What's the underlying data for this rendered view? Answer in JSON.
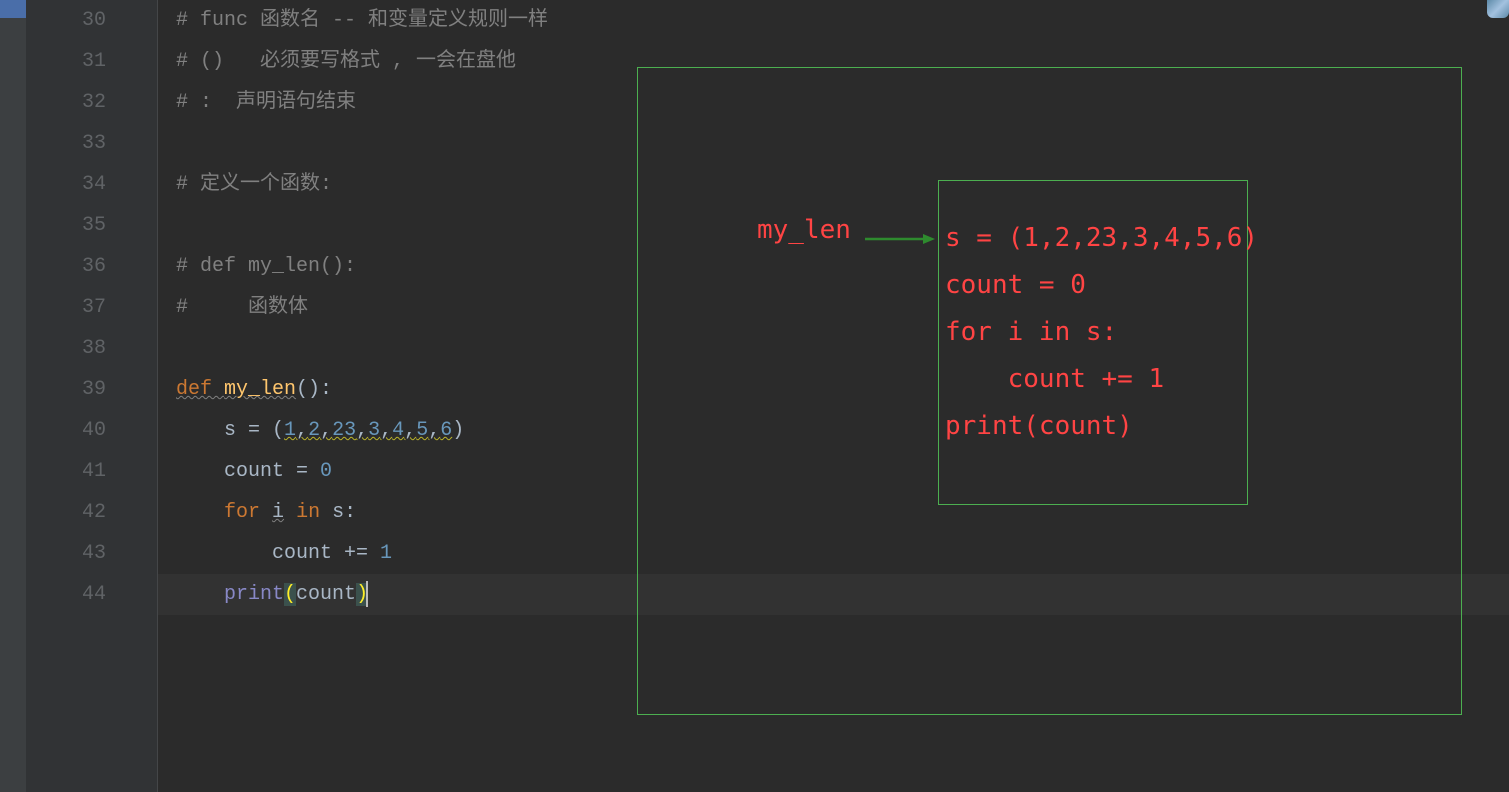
{
  "lines": [
    {
      "num": 30,
      "tokens": [
        [
          "comment",
          "# func 函数名 -- 和变量定义规则一样"
        ]
      ]
    },
    {
      "num": 31,
      "tokens": [
        [
          "comment",
          "# ()   必须要写格式 , 一会在盘他"
        ]
      ]
    },
    {
      "num": 32,
      "tokens": [
        [
          "comment",
          "# :  声明语句结束"
        ]
      ]
    },
    {
      "num": 33,
      "tokens": []
    },
    {
      "num": 34,
      "tokens": [
        [
          "comment",
          "# 定义一个函数:"
        ]
      ]
    },
    {
      "num": 35,
      "tokens": []
    },
    {
      "num": 36,
      "tokens": [
        [
          "comment",
          "# def my_len():"
        ]
      ]
    },
    {
      "num": 37,
      "tokens": [
        [
          "comment",
          "#     函数体"
        ]
      ],
      "fold": "–"
    },
    {
      "num": 38,
      "tokens": []
    },
    {
      "num": 39,
      "tokens": [
        [
          "keyword-wavy",
          "def "
        ],
        [
          "funcname-wavy",
          "my_len"
        ],
        [
          "text",
          "():"
        ]
      ],
      "fold": "–"
    },
    {
      "num": 40,
      "tokens": [
        [
          "text",
          "    s = ("
        ],
        [
          "number-wavy",
          "1"
        ],
        [
          "comma-wavy",
          ","
        ],
        [
          "number-wavy",
          "2"
        ],
        [
          "comma-wavy",
          ","
        ],
        [
          "number-wavy",
          "23"
        ],
        [
          "comma-wavy",
          ","
        ],
        [
          "number-wavy",
          "3"
        ],
        [
          "comma-wavy",
          ","
        ],
        [
          "number-wavy",
          "4"
        ],
        [
          "comma-wavy",
          ","
        ],
        [
          "number-wavy",
          "5"
        ],
        [
          "comma-wavy",
          ","
        ],
        [
          "number-wavy",
          "6"
        ],
        [
          "text",
          ")"
        ]
      ]
    },
    {
      "num": 41,
      "tokens": [
        [
          "text",
          "    count = "
        ],
        [
          "number",
          "0"
        ]
      ]
    },
    {
      "num": 42,
      "tokens": [
        [
          "text",
          "    "
        ],
        [
          "keyword",
          "for "
        ],
        [
          "text-wavy",
          "i"
        ],
        [
          "text",
          " "
        ],
        [
          "keyword",
          "in "
        ],
        [
          "text",
          "s:"
        ]
      ]
    },
    {
      "num": 43,
      "tokens": [
        [
          "text",
          "        count += "
        ],
        [
          "number",
          "1"
        ]
      ]
    },
    {
      "num": 44,
      "tokens": [
        [
          "text",
          "    "
        ],
        [
          "builtin",
          "print"
        ],
        [
          "paren-match",
          "("
        ],
        [
          "text",
          "count"
        ],
        [
          "paren-match",
          ")"
        ],
        [
          "caret",
          ""
        ]
      ],
      "current": true
    }
  ],
  "annotation": {
    "label": "my_len",
    "inner_code": "s = (1,2,23,3,4,5,6)\ncount = 0\nfor i in s:\n    count += 1\nprint(count)"
  }
}
